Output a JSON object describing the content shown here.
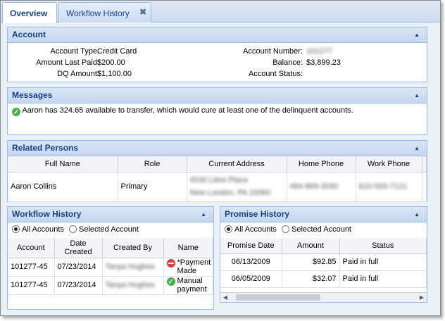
{
  "tabs": [
    {
      "label": "Overview",
      "active": true
    },
    {
      "label": "Workflow History",
      "active": false,
      "close_glyph": "✖"
    }
  ],
  "account": {
    "title": "Account",
    "left": [
      {
        "label": "Account Type:",
        "value": "Credit Card"
      },
      {
        "label": "Amount Last Paid:",
        "value": "$200.00"
      },
      {
        "label": "DQ Amount:",
        "value": "$1,100.00"
      }
    ],
    "right": [
      {
        "label": "Account Number:",
        "value": "101277"
      },
      {
        "label": "Balance:",
        "value": "$3,899.23"
      },
      {
        "label": "Account Status:",
        "value": ""
      }
    ]
  },
  "messages": {
    "title": "Messages",
    "text": "Aaron has 324.65 available to transfer, which would cure at least one of the delinquent accounts."
  },
  "related_persons": {
    "title": "Related Persons",
    "columns": [
      "Full Name",
      "Role",
      "Current Address",
      "Home Phone",
      "Work Phone"
    ],
    "rows": [
      {
        "name": "Aaron Collins",
        "role": "Primary",
        "address1": "4530 Libre Place",
        "address2": "New London, PA 19360",
        "home": "484-869-3030",
        "work": "610-593-7121"
      }
    ]
  },
  "workflow_history": {
    "title": "Workflow History",
    "radio_all": "All Accounts",
    "radio_selected": "Selected Account",
    "columns": [
      "Account",
      "Date Created",
      "Created By",
      "Name"
    ],
    "rows": [
      {
        "account": "101277-45",
        "date": "07/23/2014",
        "by": "Tanya Hughes",
        "name": "*Payment Made",
        "status": "stop"
      },
      {
        "account": "101277-45",
        "date": "07/23/2014",
        "by": "Tanya Hughes",
        "name": "Manual payment",
        "status": "ok"
      }
    ]
  },
  "promise_history": {
    "title": "Promise History",
    "radio_all": "All Accounts",
    "radio_selected": "Selected Account",
    "columns": [
      "Promise Date",
      "Amount",
      "Status"
    ],
    "rows": [
      {
        "date": "06/13/2009",
        "amount": "$92.85",
        "status": "Paid in full"
      },
      {
        "date": "06/05/2009",
        "amount": "$32.07",
        "status": "Paid in full"
      }
    ]
  },
  "colors": {
    "header_text": "#15428b",
    "panel_border": "#99bbe8",
    "ok_green": "#4caf50",
    "stop_red": "#e23b3b"
  }
}
